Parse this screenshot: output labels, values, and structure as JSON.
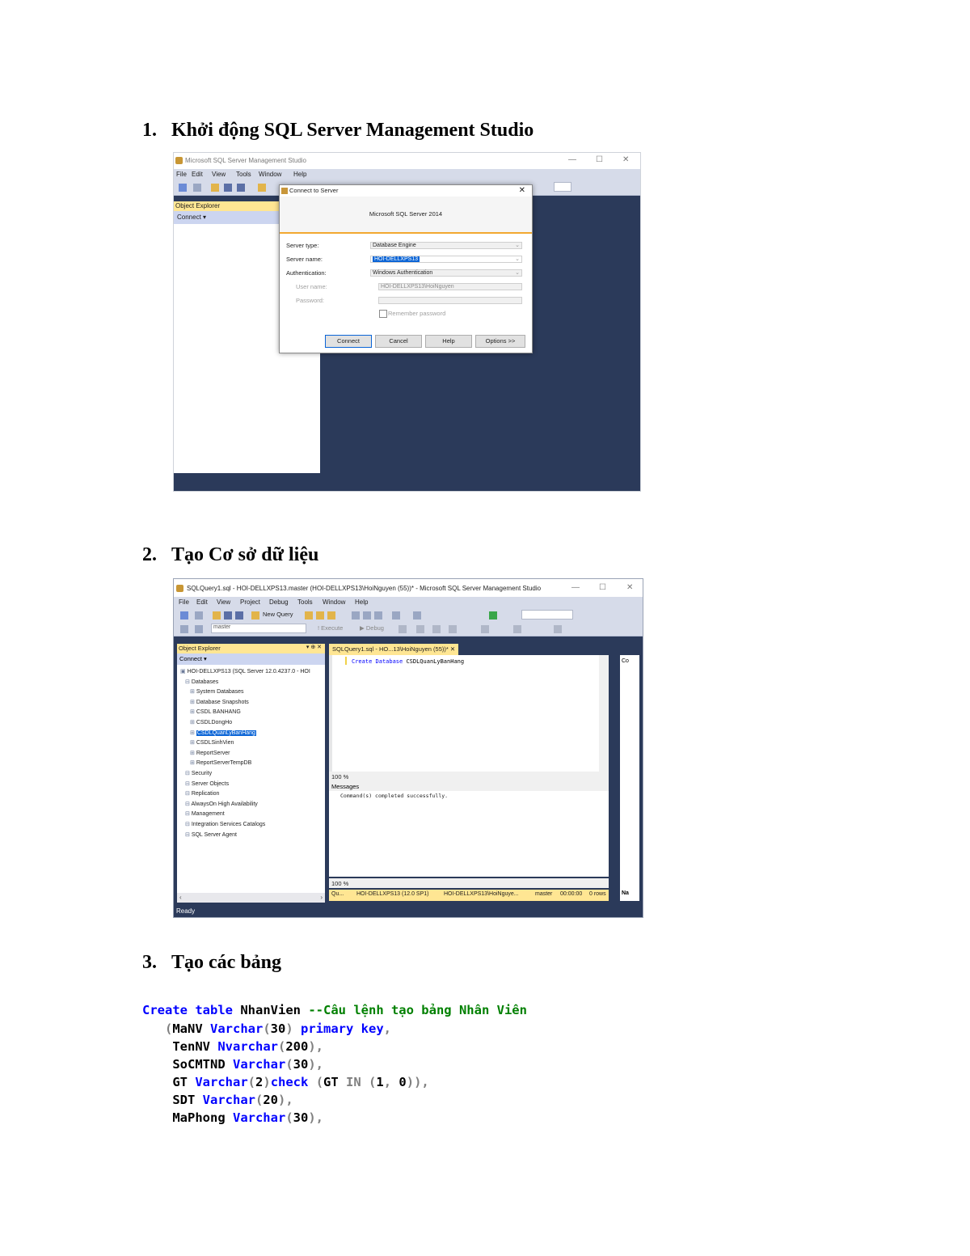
{
  "sections": [
    {
      "number": "1.",
      "title": "Khởi động SQL Server Management Studio"
    },
    {
      "number": "2.",
      "title": "Tạo Cơ sở dữ liệu"
    },
    {
      "number": "3.",
      "title": "Tạo các bảng"
    }
  ],
  "shot1": {
    "window_title": "Microsoft SQL Server Management Studio",
    "menu": [
      "File",
      "Edit",
      "View",
      "Tools",
      "Window",
      "Help"
    ],
    "object_explorer_title": "Object Explorer",
    "connect_label": "Connect ▾",
    "dialog": {
      "title": "Connect to Server",
      "banner": "Microsoft SQL Server 2014",
      "server_type_label": "Server type:",
      "server_type_value": "Database Engine",
      "server_name_label": "Server name:",
      "server_name_value": "HOI-DELLXPS13",
      "authentication_label": "Authentication:",
      "authentication_value": "Windows Authentication",
      "user_name_label": "User name:",
      "user_name_value": "HOI-DELLXPS13\\HoiNguyen",
      "password_label": "Password:",
      "remember_label": "Remember password",
      "buttons": [
        "Connect",
        "Cancel",
        "Help",
        "Options >>"
      ]
    }
  },
  "shot2": {
    "window_title": "SQLQuery1.sql - HOI-DELLXPS13.master (HOI-DELLXPS13\\HoiNguyen (55))* - Microsoft SQL Server Management Studio",
    "menu": [
      "File",
      "Edit",
      "View",
      "Project",
      "Debug",
      "Tools",
      "Window",
      "Help"
    ],
    "new_query_label": "New Query",
    "database_combo": "master",
    "execute_label": "Execute",
    "debug_label": "Debug",
    "object_explorer_title": "Object Explorer",
    "connect_label": "Connect ▾",
    "tree": [
      {
        "label": "HOI-DELLXPS13 (SQL Server 12.0.4237.0 - HOI",
        "level": 0
      },
      {
        "label": "Databases",
        "level": 1
      },
      {
        "label": "System Databases",
        "level": 2
      },
      {
        "label": "Database Snapshots",
        "level": 2
      },
      {
        "label": "CSDL BANHANG",
        "level": 2
      },
      {
        "label": "CSDLDongHo",
        "level": 2
      },
      {
        "label": "CSDLQuanLyBanHang",
        "level": 2,
        "selected": true
      },
      {
        "label": "CSDLSinhVien",
        "level": 2
      },
      {
        "label": "ReportServer",
        "level": 2
      },
      {
        "label": "ReportServerTempDB",
        "level": 2
      },
      {
        "label": "Security",
        "level": 1
      },
      {
        "label": "Server Objects",
        "level": 1
      },
      {
        "label": "Replication",
        "level": 1
      },
      {
        "label": "AlwaysOn High Availability",
        "level": 1
      },
      {
        "label": "Management",
        "level": 1
      },
      {
        "label": "Integration Services Catalogs",
        "level": 1
      },
      {
        "label": "SQL Server Agent",
        "level": 1
      }
    ],
    "tab_label": "SQLQuery1.sql - HO...13\\HoiNguyen (55))*  ✕",
    "code_keyword1": "Create",
    "code_keyword2": "Database",
    "code_name": "CSDLQuanLyBanHang",
    "zoom": "100 %",
    "messages_tab": "Messages",
    "message_text": "Command(s) completed successfully.",
    "query_status": [
      "Qu...",
      "HOI-DELLXPS13 (12.0 SP1)",
      "HOI-DELLXPS13\\HoiNguye...",
      "master",
      "00:00:00",
      "0 rows"
    ],
    "right_panel_top": "Co",
    "right_panel_bottom": "Na",
    "status": "Ready"
  },
  "code_lines": [
    [
      {
        "t": "Create table ",
        "c": "k"
      },
      {
        "t": "NhanVien ",
        "c": ""
      },
      {
        "t": "--Câu lệnh tạo bảng Nhân Viên",
        "c": "c"
      }
    ],
    [
      {
        "t": "   (",
        "c": "g"
      },
      {
        "t": "MaNV ",
        "c": ""
      },
      {
        "t": "Varchar",
        "c": "k"
      },
      {
        "t": "(",
        "c": "g"
      },
      {
        "t": "30",
        "c": ""
      },
      {
        "t": ") ",
        "c": "g"
      },
      {
        "t": "primary key",
        "c": "k"
      },
      {
        "t": ",",
        "c": "g"
      }
    ],
    [
      {
        "t": "    TenNV ",
        "c": ""
      },
      {
        "t": "Nvarchar",
        "c": "k"
      },
      {
        "t": "(",
        "c": "g"
      },
      {
        "t": "200",
        "c": ""
      },
      {
        "t": "),",
        "c": "g"
      }
    ],
    [
      {
        "t": "    SoCMTND ",
        "c": ""
      },
      {
        "t": "Varchar",
        "c": "k"
      },
      {
        "t": "(",
        "c": "g"
      },
      {
        "t": "30",
        "c": ""
      },
      {
        "t": "),",
        "c": "g"
      }
    ],
    [
      {
        "t": "    GT ",
        "c": ""
      },
      {
        "t": "Varchar",
        "c": "k"
      },
      {
        "t": "(",
        "c": "g"
      },
      {
        "t": "2",
        "c": ""
      },
      {
        "t": ")",
        "c": "g"
      },
      {
        "t": "check ",
        "c": "k"
      },
      {
        "t": "(",
        "c": "g"
      },
      {
        "t": "GT ",
        "c": ""
      },
      {
        "t": "IN ",
        "c": "g"
      },
      {
        "t": "(",
        "c": "g"
      },
      {
        "t": "1",
        "c": ""
      },
      {
        "t": ", ",
        "c": "g"
      },
      {
        "t": "0",
        "c": ""
      },
      {
        "t": ")),",
        "c": "g"
      }
    ],
    [
      {
        "t": "    SDT ",
        "c": ""
      },
      {
        "t": "Varchar",
        "c": "k"
      },
      {
        "t": "(",
        "c": "g"
      },
      {
        "t": "20",
        "c": ""
      },
      {
        "t": "),",
        "c": "g"
      }
    ],
    [
      {
        "t": "    MaPhong ",
        "c": ""
      },
      {
        "t": "Varchar",
        "c": "k"
      },
      {
        "t": "(",
        "c": "g"
      },
      {
        "t": "30",
        "c": ""
      },
      {
        "t": "),",
        "c": "g"
      }
    ]
  ]
}
